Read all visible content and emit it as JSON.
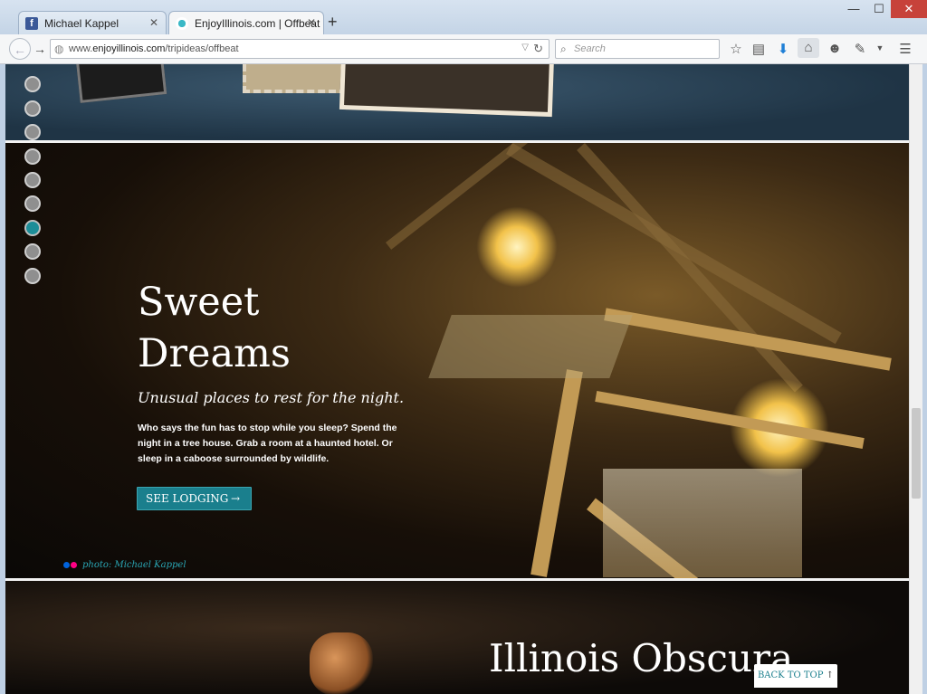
{
  "browser": {
    "tabs": [
      {
        "title": "Michael Kappel",
        "active": false
      },
      {
        "title": "EnjoyIllinois.com | Offbeat ...",
        "active": true
      }
    ],
    "new_tab": "+",
    "url": {
      "prefix": "www.",
      "domain": "enjoyillinois.com",
      "path": "/tripideas/offbeat"
    },
    "search_placeholder": "Search",
    "window_buttons": {
      "minimize": "—",
      "maximize": "☐",
      "close": "✕"
    }
  },
  "page": {
    "section_dots": {
      "count": 9,
      "active_index": 6
    },
    "section": {
      "title": "Sweet Dreams",
      "subtitle": "Unusual places to rest for the night.",
      "description": "Who says the fun has to stop while you sleep? Spend the night in a tree house. Grab a room at a haunted hotel. Or sleep in a caboose surrounded by wildlife.",
      "cta_label": "SEE LODGING",
      "credit": "photo: Michael Kappel"
    },
    "next_section_title": "Illinois Obscura",
    "back_to_top": "BACK TO TOP"
  },
  "colors": {
    "accent": "#1a7f8d",
    "credit": "#2aa5b3",
    "flickr_blue": "#0063dc",
    "flickr_pink": "#ff0084",
    "facebook": "#3b5998"
  }
}
